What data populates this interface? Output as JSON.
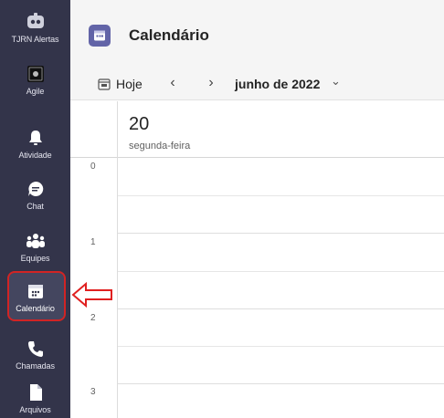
{
  "rail": {
    "items": [
      {
        "label": "TJRN Alertas",
        "icon": "alert-app-icon"
      },
      {
        "label": "Agile",
        "icon": "agile-app-icon"
      },
      {
        "label": "Atividade",
        "icon": "bell-icon"
      },
      {
        "label": "Chat",
        "icon": "chat-icon"
      },
      {
        "label": "Equipes",
        "icon": "teams-icon"
      },
      {
        "label": "Calendário",
        "icon": "calendar-icon",
        "active": true
      },
      {
        "label": "Chamadas",
        "icon": "phone-icon"
      },
      {
        "label": "Arquivos",
        "icon": "file-icon"
      }
    ],
    "background": "#33344a",
    "highlight_color": "#d12424"
  },
  "header": {
    "title": "Calendário",
    "accent": "#6264a7"
  },
  "toolbar": {
    "today_label": "Hoje",
    "prev_glyph": "‹",
    "next_glyph": "›",
    "month_label": "junho de 2022",
    "month_caret": "⌄"
  },
  "day": {
    "number": "20",
    "weekday": "segunda-feira"
  },
  "hours": [
    "0",
    "1",
    "2",
    "3"
  ]
}
